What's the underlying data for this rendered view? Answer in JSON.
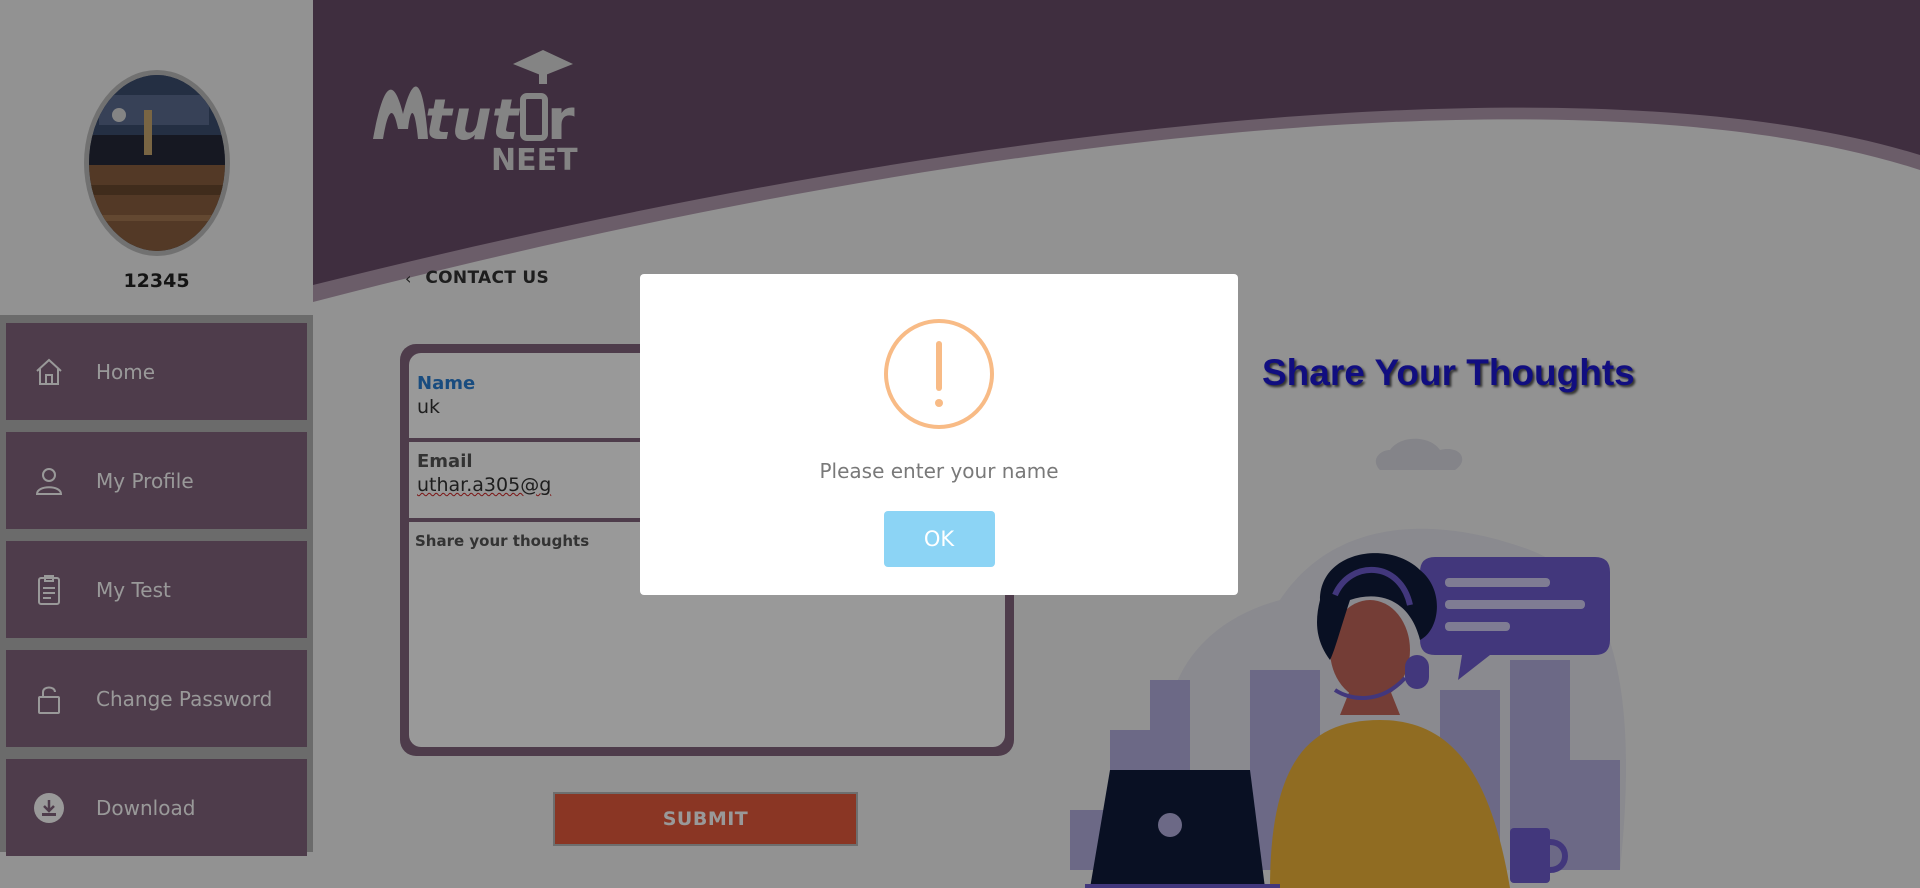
{
  "profile": {
    "user_id": "12345"
  },
  "sidebar": {
    "items": [
      {
        "label": "Home",
        "icon": "home-icon"
      },
      {
        "label": "My Profile",
        "icon": "user-icon"
      },
      {
        "label": "My Test",
        "icon": "clipboard-icon"
      },
      {
        "label": "Change Password",
        "icon": "lock-icon"
      },
      {
        "label": "Download",
        "icon": "download-icon"
      }
    ]
  },
  "header": {
    "logo_text": "Mtutor",
    "logo_sub": "NEET"
  },
  "breadcrumb": {
    "back_icon": "chevron-left-icon",
    "label": "CONTACT US"
  },
  "form": {
    "name_label": "Name",
    "name_value": "uk",
    "email_label": "Email",
    "email_value": "uthar.a305@g",
    "thoughts_placeholder": "Share your thoughts",
    "submit_label": "SUBMIT"
  },
  "content": {
    "title": "Share Your Thoughts"
  },
  "modal": {
    "icon": "warning-icon",
    "message": "Please enter your name",
    "ok_label": "OK"
  },
  "colors": {
    "header_purple": "#6a4e69",
    "menu_purple": "#83647e",
    "submit_orange": "#e65a3c",
    "title_blue": "#1d18d6",
    "warning_orange": "#f8bb86",
    "ok_blue": "#8cd4f5"
  }
}
